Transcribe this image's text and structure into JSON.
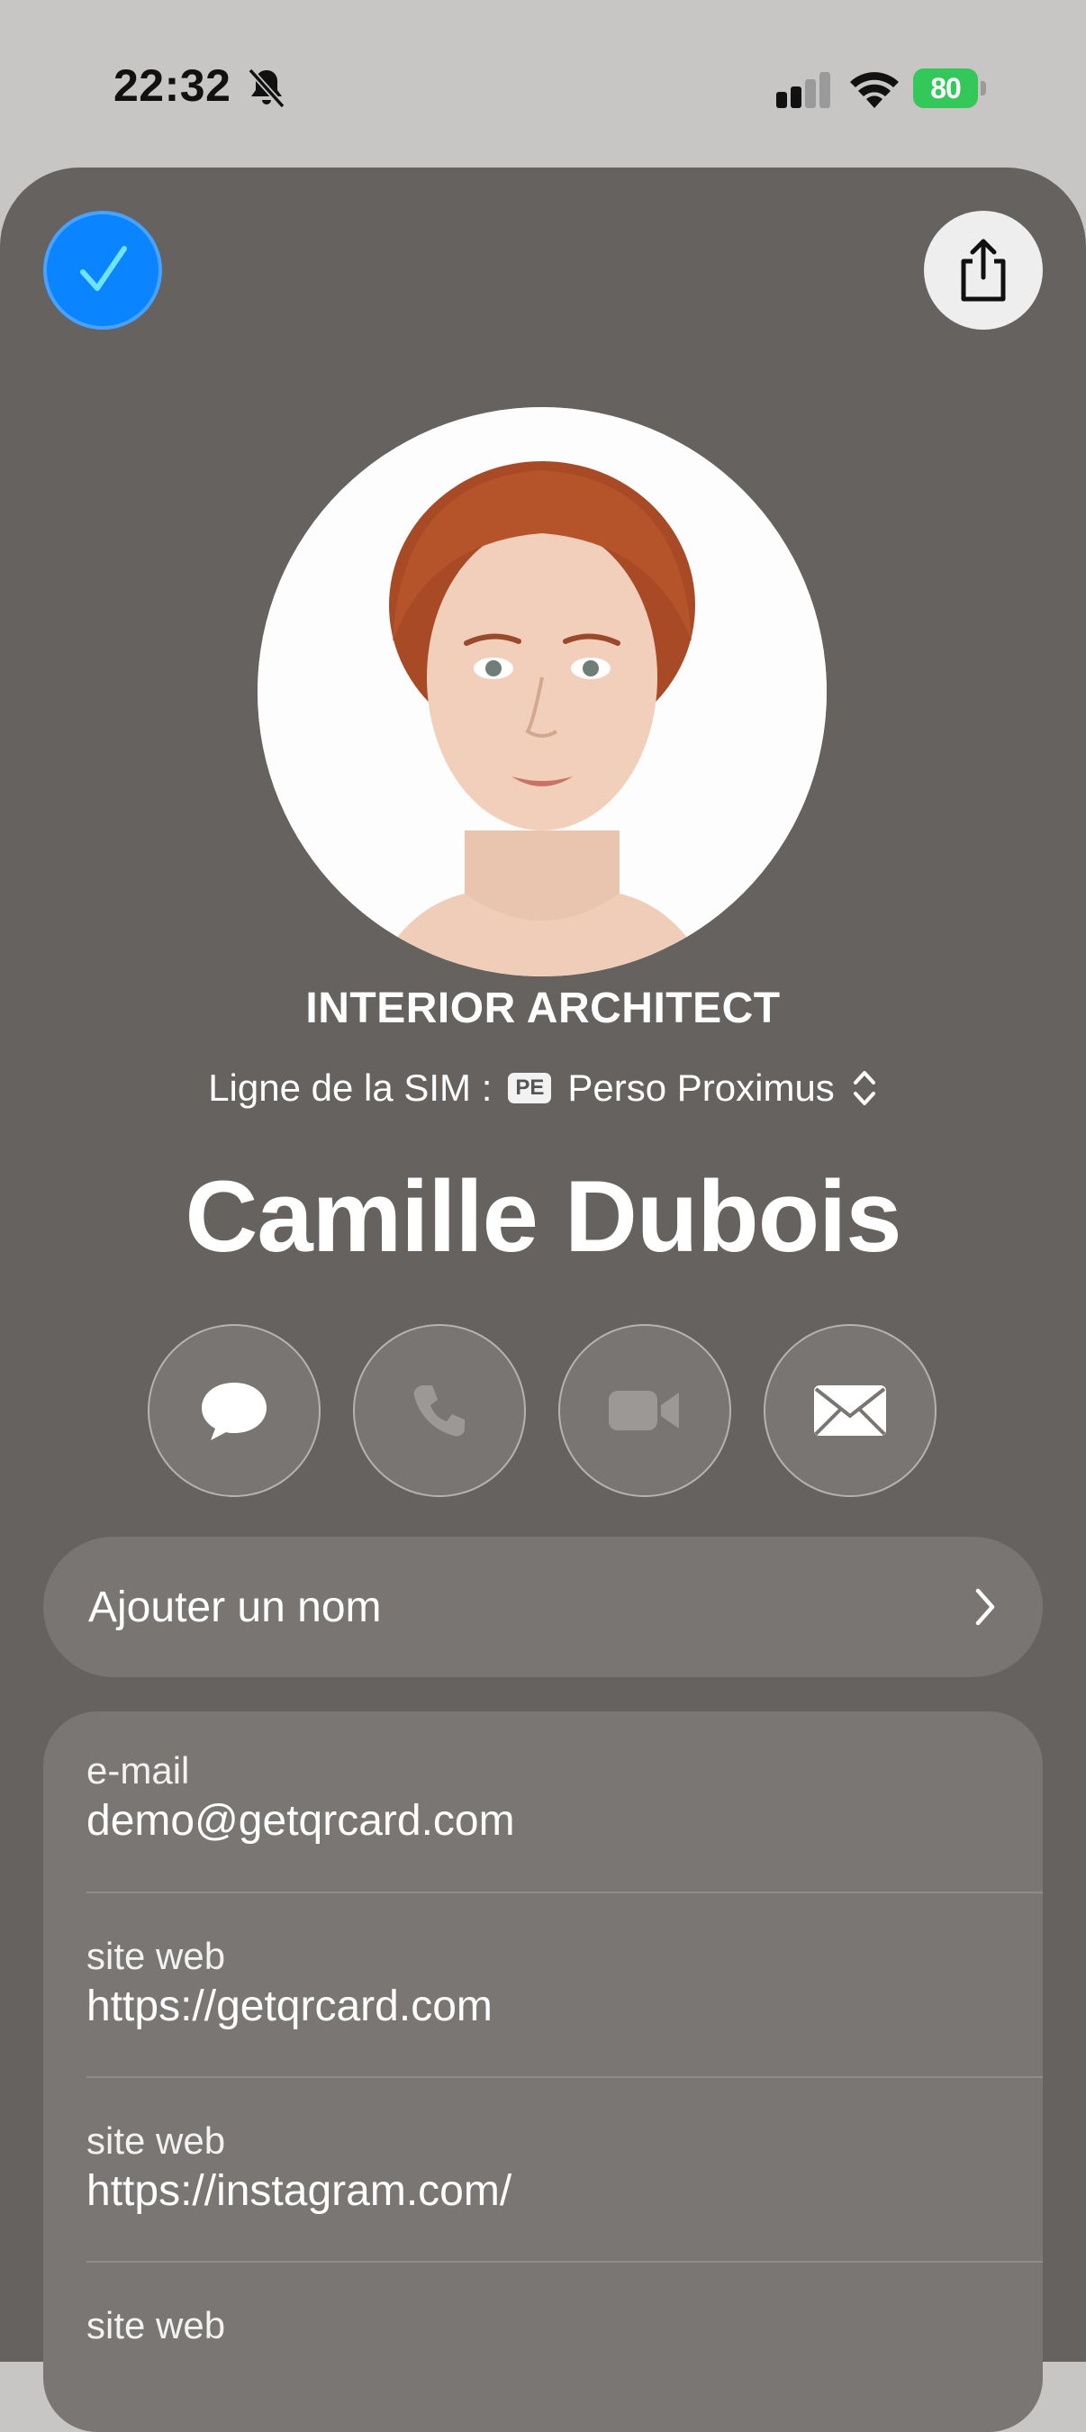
{
  "status_bar": {
    "time": "22:32",
    "battery_level": "80",
    "battery_color": "#34c759"
  },
  "header": {
    "done_icon": "checkmark-icon",
    "share_icon": "share-icon"
  },
  "contact": {
    "job_title": "INTERIOR ARCHITECT",
    "sim_label": "Ligne de la SIM :",
    "sim_badge": "PE",
    "sim_value": "Perso Proximus",
    "name": "Camille Dubois"
  },
  "actions": [
    "message-icon",
    "phone-icon",
    "video-icon",
    "mail-icon"
  ],
  "add_name": {
    "label": "Ajouter un nom"
  },
  "fields": [
    {
      "label": "e-mail",
      "value": "demo@getqrcard.com"
    },
    {
      "label": "site web",
      "value": "https://getqrcard.com"
    },
    {
      "label": "site web",
      "value": "https://instagram.com/"
    },
    {
      "label": "site web",
      "value": ""
    }
  ],
  "colors": {
    "sheet_bg": "#656260",
    "accent": "#0a84ff"
  }
}
